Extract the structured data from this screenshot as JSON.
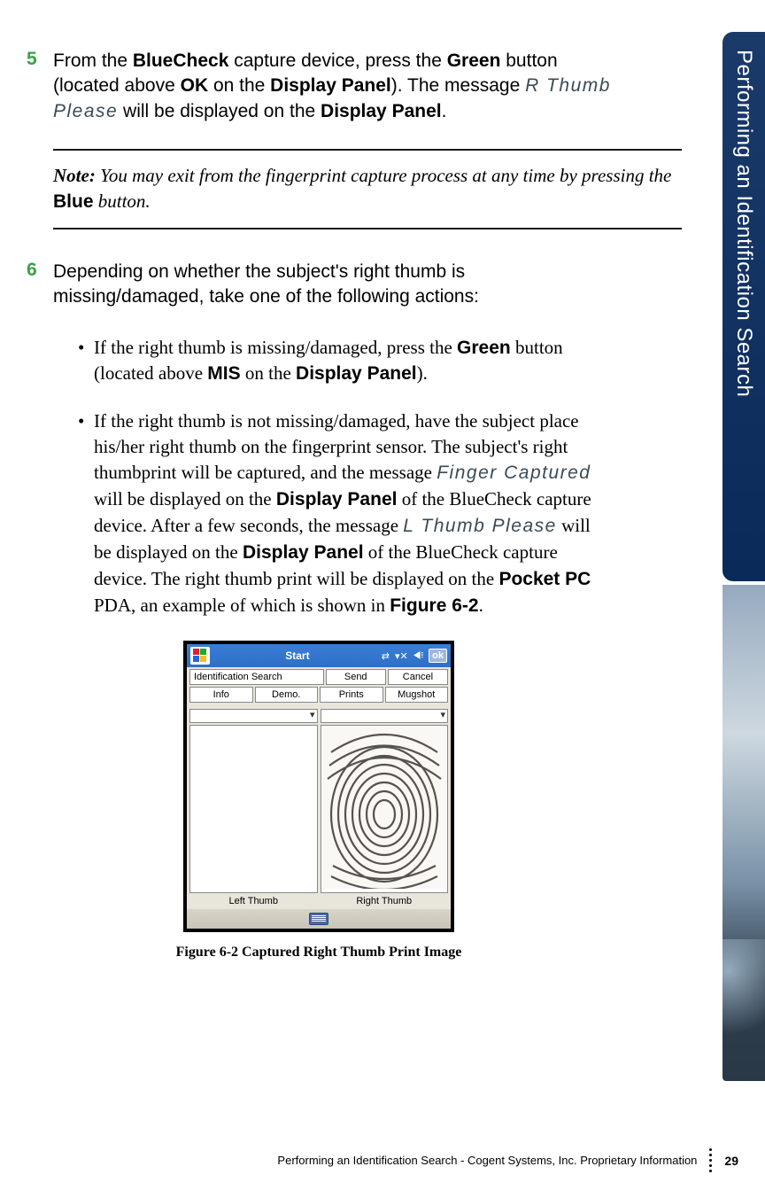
{
  "side_tab": "Performing an Identification Search",
  "step5": {
    "num": "5",
    "t1": "From the ",
    "b1": "BlueCheck",
    "t2": " capture device, press the ",
    "b2": "Green",
    "t3": " button (located above ",
    "b3": "OK",
    "t4": " on the ",
    "b4": "Display Panel",
    "t5": "). The message ",
    "m1": "R Thumb Please",
    "t6": " will be displayed on the ",
    "b5": "Display Panel",
    "t7": "."
  },
  "note": {
    "label": "Note:",
    "t1": " You may exit from the fingerprint capture process at any time by pressing the ",
    "b1": "Blue",
    "t2": " button."
  },
  "step6": {
    "num": "6",
    "text": "Depending on whether the subject's right thumb is missing/damaged, take one of the following actions:"
  },
  "sub1": {
    "t1": "If the right thumb is missing/damaged, press the ",
    "b1": "Green",
    "t2": " button (located above ",
    "b2": "MIS",
    "t3": " on the ",
    "b3": "Display Panel",
    "t4": ")."
  },
  "sub2": {
    "t1": "If the right thumb is not missing/damaged, have the subject place his/her right thumb on the fingerprint sensor. The subject's right thumbprint will be captured, and the message ",
    "m1": "Finger Captured",
    "t2": " will be displayed on the ",
    "b1": "Display Panel",
    "t3": " of the BlueCheck capture device. After a few seconds, the message ",
    "m2": "L Thumb Please",
    "t4": " will be displayed on the ",
    "b2": "Display Panel",
    "t5": " of the BlueCheck capture device. The right thumb print will be displayed on the ",
    "b3": "Pocket PC",
    "t6": " PDA, an example of which is shown in ",
    "b4": "Figure 6-2",
    "t7": "."
  },
  "pda": {
    "start": "Start",
    "ok": "ok",
    "row1": {
      "a": "Identification Search",
      "b": "Send",
      "c": "Cancel"
    },
    "row2": {
      "a": "Info",
      "b": "Demo.",
      "c": "Prints",
      "d": "Mugshot"
    },
    "left_label": "Left Thumb",
    "right_label": "Right Thumb"
  },
  "caption": "Figure 6-2 Captured Right Thumb Print Image",
  "footer": {
    "text": "Performing an Identification Search  - Cogent Systems, Inc. Proprietary Information",
    "page": "29"
  }
}
